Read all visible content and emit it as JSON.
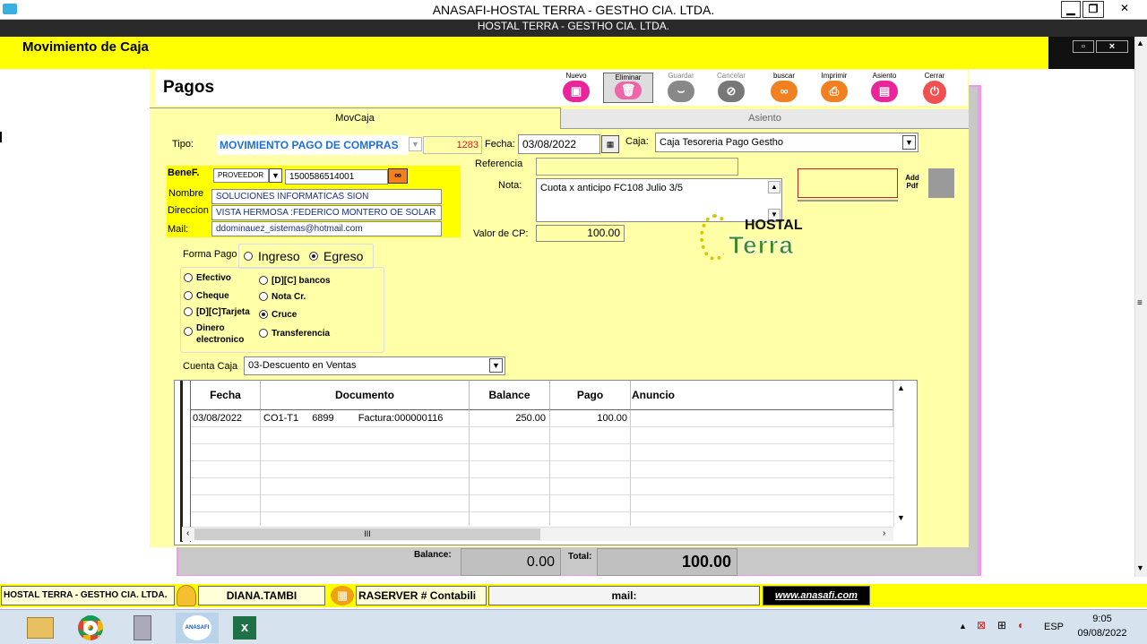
{
  "window": {
    "title": "ANASAFI-HOSTAL TERRA - GESTHO CIA. LTDA.",
    "subtitle": "HOSTAL TERRA - GESTHO CIA. LTDA.",
    "min": "▁",
    "restore": "❐",
    "close": "✕"
  },
  "module_title": "Movimiento de Caja",
  "form": {
    "title": "Pagos",
    "toolbar": [
      {
        "label": "Nuevo",
        "icon": "new-icon",
        "color": "#e8259a",
        "enabled": true
      },
      {
        "label": "Eliminar",
        "icon": "trash-icon",
        "color": "#ee66aa",
        "enabled": true
      },
      {
        "label": "Guardar",
        "icon": "save-icon",
        "color": "#888888",
        "enabled": false
      },
      {
        "label": "Cancelar",
        "icon": "cancel-icon",
        "color": "#777777",
        "enabled": false
      },
      {
        "label": "buscar",
        "icon": "binoculars-icon",
        "color": "#f08020",
        "enabled": true
      },
      {
        "label": "Imprimir",
        "icon": "printer-icon",
        "color": "#f08020",
        "enabled": true
      },
      {
        "label": "Asiento",
        "icon": "ledger-icon",
        "color": "#e8259a",
        "enabled": true
      },
      {
        "label": "Cerrar",
        "icon": "power-icon",
        "color": "#f05050",
        "enabled": true
      }
    ],
    "tabs": {
      "active": "MovCaja",
      "inactive": "Asiento"
    },
    "tipo_label": "Tipo:",
    "tipo_value": "MOVIMIENTO PAGO DE COMPRAS",
    "tipo_number": "1283",
    "fecha_label": "Fecha:",
    "fecha_value": "03/08/2022",
    "caja_label": "Caja:",
    "caja_value": "Caja Tesoreria Pago Gestho",
    "benef_label": "BeneF.",
    "benef_type": "PROVEEDOR",
    "benef_id": "1500586514001",
    "nombre_label": "Nombre",
    "nombre_value": "SOLUCIONES INFORMATICAS SION",
    "direccion_label": "Direccion",
    "direccion_value": "VISTA HERMOSA :FEDERICO MONTERO OE SOLAR",
    "mail_label": "Mail:",
    "mail_value": "ddominauez_sistemas@hotmail.com",
    "referencia_label": "Referencia",
    "referencia_value": "",
    "nota_label": "Nota:",
    "nota_value": "Cuota x anticipo FC108 Julio 3/5",
    "valor_label": "Valor de CP:",
    "valor_value": "100.00",
    "add_pdf": "Add Pdf",
    "logo_top": "HOSTAL",
    "logo_bottom": "Terra",
    "forma_pago_label": "Forma Pago",
    "ingreso": "Ingreso",
    "egreso": "Egreso",
    "pay_options": [
      {
        "label": "Efectivo",
        "selected": false
      },
      {
        "label": "Cheque",
        "selected": false
      },
      {
        "label": "[D][C]Tarjeta",
        "selected": false
      },
      {
        "label": "Dinero electronico",
        "selected": false
      },
      {
        "label": "[D][C] bancos",
        "selected": false
      },
      {
        "label": "Nota Cr.",
        "selected": false
      },
      {
        "label": "Cruce",
        "selected": true
      },
      {
        "label": "Transferencia",
        "selected": false
      }
    ],
    "cuenta_label": "Cuenta Caja",
    "cuenta_value": "03-Descuento en Ventas",
    "grid": {
      "headers": [
        "Fecha",
        "Documento",
        "Balance",
        "Pago",
        "Anuncio"
      ],
      "rows": [
        {
          "fecha": "03/08/2022",
          "doc1": "CO1-T1",
          "doc2": "6899",
          "doc3": "Factura:000000116",
          "balance": "250.00",
          "pago": "100.00",
          "anuncio": ""
        }
      ],
      "hscroll": "III"
    },
    "balance_label": "Balance:",
    "balance_value": "0.00",
    "total_label": "Total:",
    "total_value": "100.00"
  },
  "statusbar": {
    "company": "HOSTAL TERRA - GESTHO CIA. LTDA.",
    "user": "DIANA.TAMBI",
    "server": "RASERVER # Contabili",
    "mail": "mail:",
    "web": "www.anasafi.com"
  },
  "taskbar": {
    "lang": "ESP",
    "time": "9:05",
    "date": "09/08/2022",
    "apps": [
      "explorer-icon",
      "chrome-icon",
      "calculator-icon",
      "anasafi-icon",
      "excel-icon"
    ],
    "anasafi_label": "ANASAFI"
  }
}
